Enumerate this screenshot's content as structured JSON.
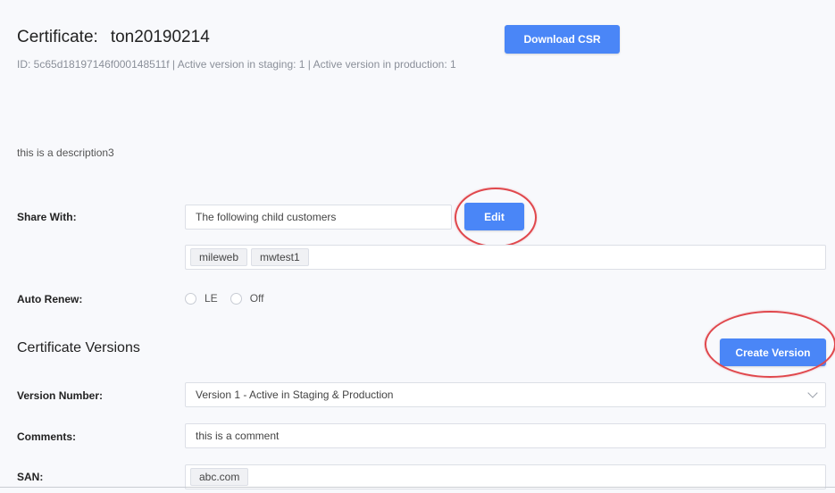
{
  "certificate": {
    "title_label": "Certificate:",
    "name": "ton20190214",
    "meta": "ID: 5c65d18197146f000148511f | Active version in staging: 1 | Active version in production: 1",
    "download_label": "Download CSR",
    "description": "this is a description3"
  },
  "share": {
    "label": "Share With",
    "colon": ":",
    "value": "The following child customers",
    "edit_label": "Edit",
    "tags": [
      "mileweb",
      "mwtest1"
    ]
  },
  "auto_renew": {
    "label": "Auto Renew",
    "colon": ":",
    "options": [
      "LE",
      "Off"
    ]
  },
  "versions": {
    "section_title": "Certificate Versions",
    "create_label": "Create Version",
    "version_label": "Version Number",
    "version_value": "Version 1 - Active in Staging & Production",
    "comments_label": "Comments",
    "comments_value": "this is a comment",
    "san_label": "SAN",
    "san_tags": [
      "abc.com"
    ],
    "colon": ":"
  },
  "colors": {
    "accent": "#4a86f7",
    "highlight": "#e0474c",
    "background": "#f8f9fc"
  },
  "icons": {
    "dropdown": "chevron-down-icon"
  }
}
